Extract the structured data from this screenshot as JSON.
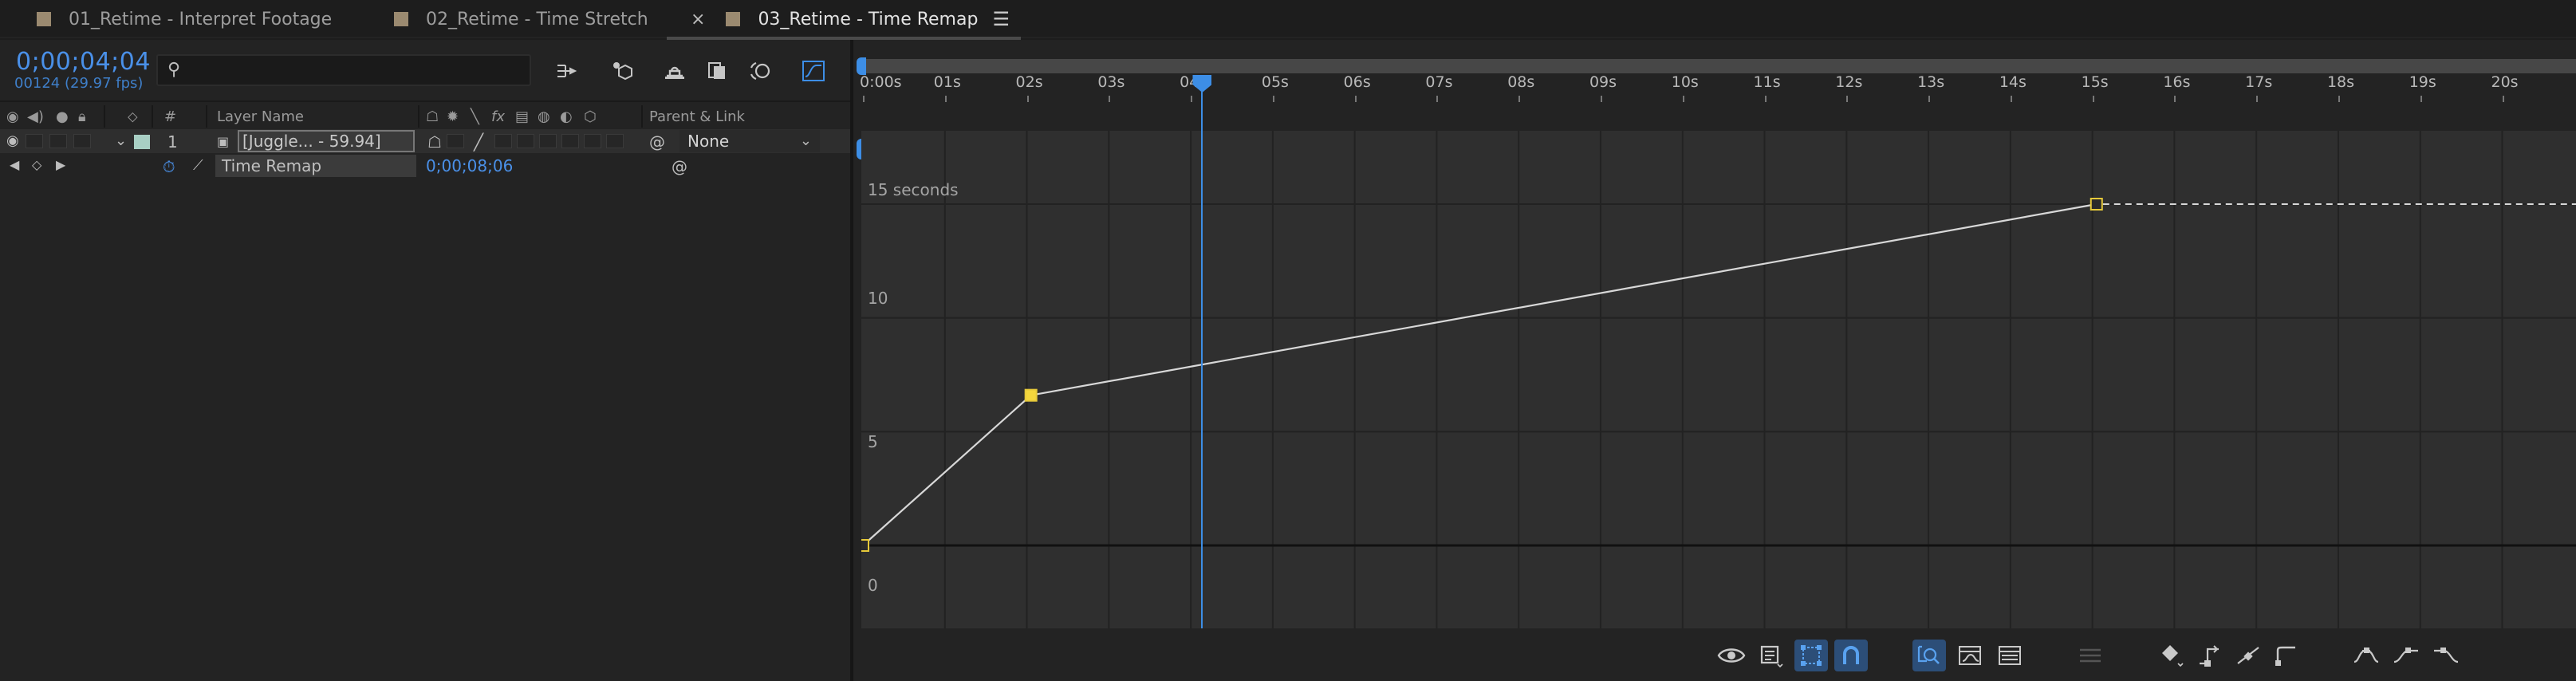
{
  "tabs": [
    {
      "label": "01_Retime - Interpret Footage",
      "active": false
    },
    {
      "label": "02_Retime - Time Stretch",
      "active": false
    },
    {
      "label": "03_Retime - Time Remap",
      "active": true,
      "close": "×",
      "menu": "☰"
    }
  ],
  "comp": {
    "timecode": "0;00;04;04",
    "frames": "00124 (29.97 fps)",
    "search": {
      "placeholder": "",
      "icon": "search-icon",
      "glyph": "⚲"
    }
  },
  "columns": {
    "number": "#",
    "layer_name": "Layer Name",
    "fx": "fx",
    "parent_link": "Parent & Link"
  },
  "layer": {
    "index": "1",
    "name": "[Juggle... - 59.94]",
    "parent": "None",
    "parent_arrow": "⌄"
  },
  "property": {
    "name": "Time Remap",
    "value": "0;00;08;06"
  },
  "ruler": {
    "ticks": [
      "0:00s",
      "01s",
      "02s",
      "03s",
      "04s",
      "05s",
      "06s",
      "07s",
      "08s",
      "09s",
      "10s",
      "11s",
      "12s",
      "13s",
      "14s",
      "15s",
      "16s",
      "17s",
      "18s",
      "19s",
      "20s"
    ]
  },
  "graph": {
    "y_top_label": "15 seconds",
    "y_labels": [
      "10",
      "5",
      "0"
    ],
    "keyframes": [
      {
        "t": 0,
        "v": 0
      },
      {
        "t": 2.05,
        "v": 6.6
      },
      {
        "t": 15.05,
        "v": 15
      }
    ],
    "playhead_seconds": 4.14,
    "x_range_seconds": [
      0,
      20.9
    ],
    "y_range_seconds": [
      0,
      15
    ],
    "colors": {
      "curve": "#d8d8d8",
      "keyframe_selected": "#f3d63d",
      "keyframe_unselected": "#2a2a2a",
      "keyframe_outline": "#e6c93a",
      "playhead": "#3d8ee6",
      "grid": "#2a2a2a",
      "graph_bg": "#2f2f2f",
      "work_area": "#3fae33"
    }
  },
  "bottom_tools": [
    {
      "icon": "eye-icon",
      "glyph": "◉"
    },
    {
      "icon": "graph-type-icon",
      "glyph": "▤"
    },
    {
      "icon": "transform-box-icon",
      "glyph": "⬚"
    },
    {
      "icon": "snap-icon",
      "glyph": "∩"
    },
    {
      "icon": "fit-selection-icon",
      "glyph": "⤡"
    },
    {
      "icon": "fit-all-icon",
      "glyph": "⊡"
    },
    {
      "icon": "separate-dimensions-icon",
      "glyph": "▦"
    },
    {
      "icon": "edit-keyframe-icon",
      "glyph": "◆"
    },
    {
      "icon": "convert-hold-icon",
      "glyph": "⌐"
    },
    {
      "icon": "convert-linear-icon",
      "glyph": "⟋"
    },
    {
      "icon": "convert-auto-bezier-icon",
      "glyph": "⌈"
    },
    {
      "icon": "easy-ease-icon",
      "glyph": "⌒"
    },
    {
      "icon": "easy-ease-in-icon",
      "glyph": "⌓"
    },
    {
      "icon": "easy-ease-out-icon",
      "glyph": "⌔"
    }
  ]
}
